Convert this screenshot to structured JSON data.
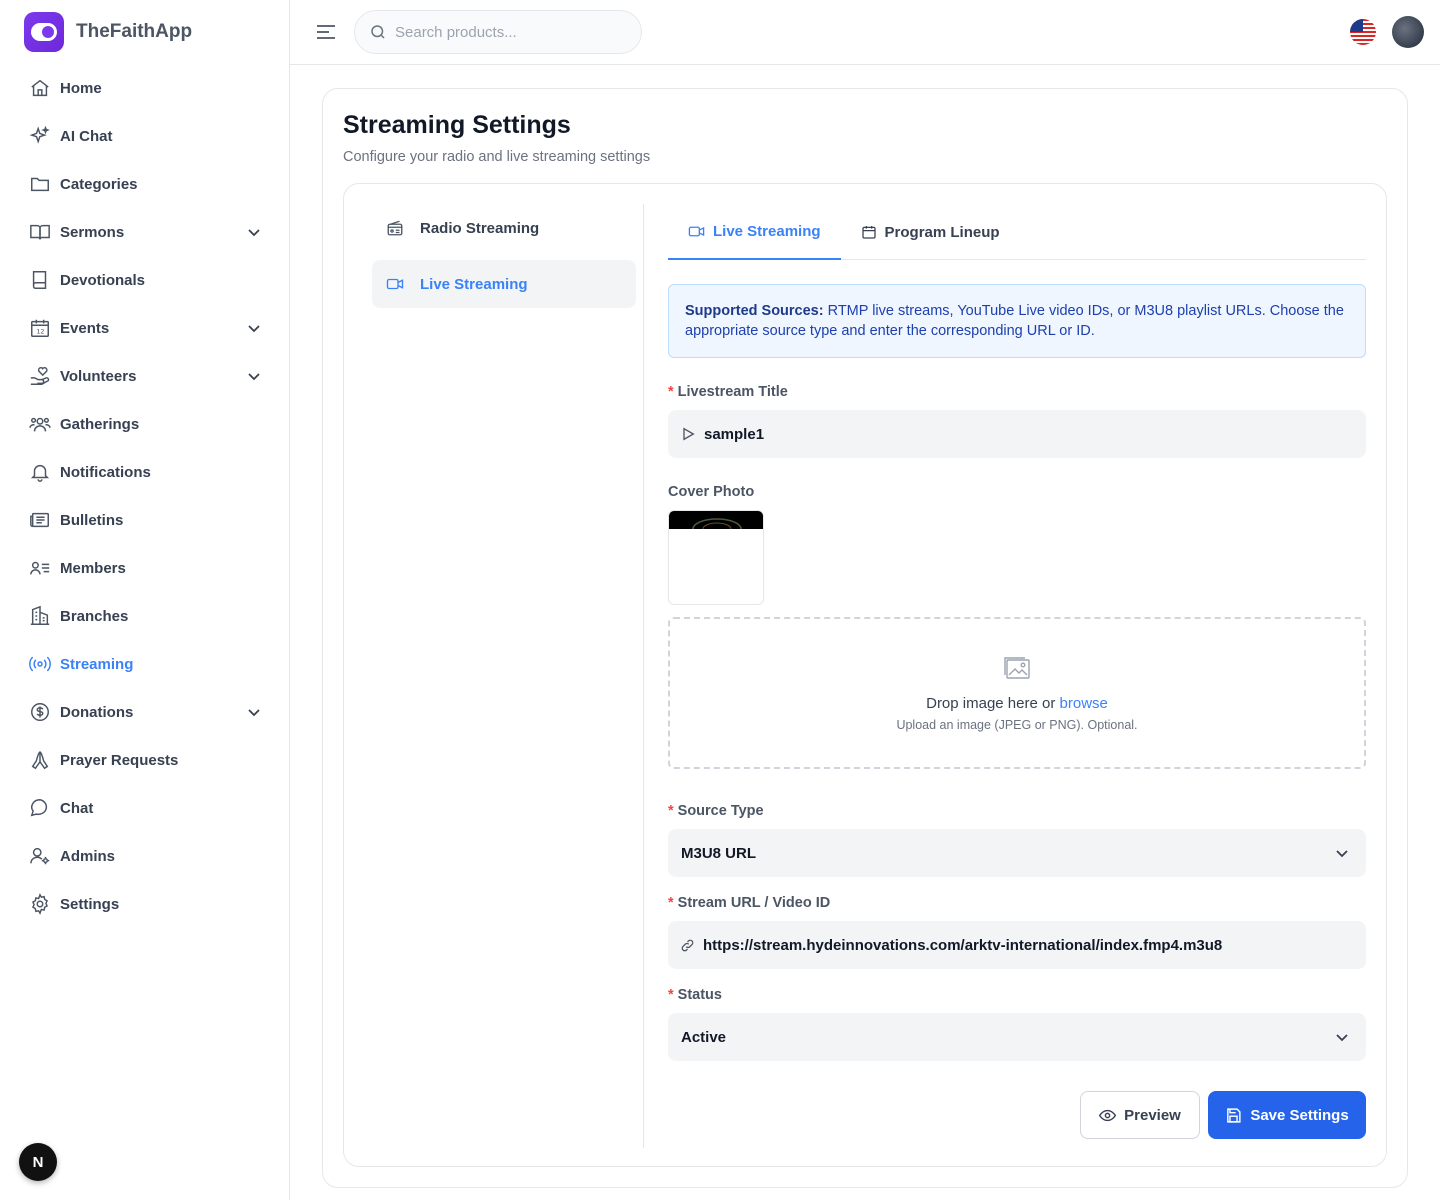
{
  "app": {
    "name": "TheFaithApp"
  },
  "sidebar": {
    "items": [
      {
        "label": "Home",
        "icon": "home-icon",
        "has_submenu": false
      },
      {
        "label": "AI Chat",
        "icon": "sparkles-icon",
        "has_submenu": false
      },
      {
        "label": "Categories",
        "icon": "folder-icon",
        "has_submenu": false
      },
      {
        "label": "Sermons",
        "icon": "book-open-icon",
        "has_submenu": true
      },
      {
        "label": "Devotionals",
        "icon": "book-icon",
        "has_submenu": false
      },
      {
        "label": "Events",
        "icon": "calendar-icon",
        "has_submenu": true
      },
      {
        "label": "Volunteers",
        "icon": "hand-heart-icon",
        "has_submenu": true
      },
      {
        "label": "Gatherings",
        "icon": "users-icon",
        "has_submenu": false
      },
      {
        "label": "Notifications",
        "icon": "bell-icon",
        "has_submenu": false
      },
      {
        "label": "Bulletins",
        "icon": "newspaper-icon",
        "has_submenu": false
      },
      {
        "label": "Members",
        "icon": "user-list-icon",
        "has_submenu": false
      },
      {
        "label": "Branches",
        "icon": "building-icon",
        "has_submenu": false
      },
      {
        "label": "Streaming",
        "icon": "broadcast-icon",
        "has_submenu": false,
        "active": true
      },
      {
        "label": "Donations",
        "icon": "dollar-circle-icon",
        "has_submenu": true
      },
      {
        "label": "Prayer Requests",
        "icon": "praying-hands-icon",
        "has_submenu": false
      },
      {
        "label": "Chat",
        "icon": "chat-bubble-icon",
        "has_submenu": false
      },
      {
        "label": "Admins",
        "icon": "user-cog-icon",
        "has_submenu": false
      },
      {
        "label": "Settings",
        "icon": "gear-icon",
        "has_submenu": false
      }
    ],
    "bottom_badge": "N"
  },
  "header": {
    "search_placeholder": "Search products..."
  },
  "page": {
    "title": "Streaming Settings",
    "subtitle": "Configure your radio and live streaming settings"
  },
  "settings_menu": {
    "items": [
      {
        "label": "Radio Streaming",
        "icon": "radio-icon"
      },
      {
        "label": "Live Streaming",
        "icon": "video-icon",
        "active": true
      }
    ]
  },
  "tabs": [
    {
      "label": "Live Streaming",
      "icon": "video-icon",
      "active": true
    },
    {
      "label": "Program Lineup",
      "icon": "calendar-icon"
    }
  ],
  "info": {
    "bold": "Supported Sources:",
    "text": " RTMP live streams, YouTube Live video IDs, or M3U8 playlist URLs. Choose the appropriate source type and enter the corresponding URL or ID."
  },
  "form": {
    "title_label": "Livestream Title",
    "title_value": "sample1",
    "cover_label": "Cover Photo",
    "dropzone_text": "Drop image here or ",
    "dropzone_link": "browse",
    "dropzone_hint": "Upload an image (JPEG or PNG). Optional.",
    "source_type_label": "Source Type",
    "source_type_value": "M3U8 URL",
    "url_label": "Stream URL / Video ID",
    "url_value": "https://stream.hydeinnovations.com/arktv-international/index.fmp4.m3u8",
    "status_label": "Status",
    "status_value": "Active",
    "required_marker": "*"
  },
  "actions": {
    "preview_label": "Preview",
    "save_label": "Save Settings"
  },
  "colors": {
    "accent": "#3b82f6",
    "primary_button": "#2563eb",
    "brand": "#7c3aed",
    "required": "#ef4444",
    "info_bg": "#eff6ff"
  }
}
